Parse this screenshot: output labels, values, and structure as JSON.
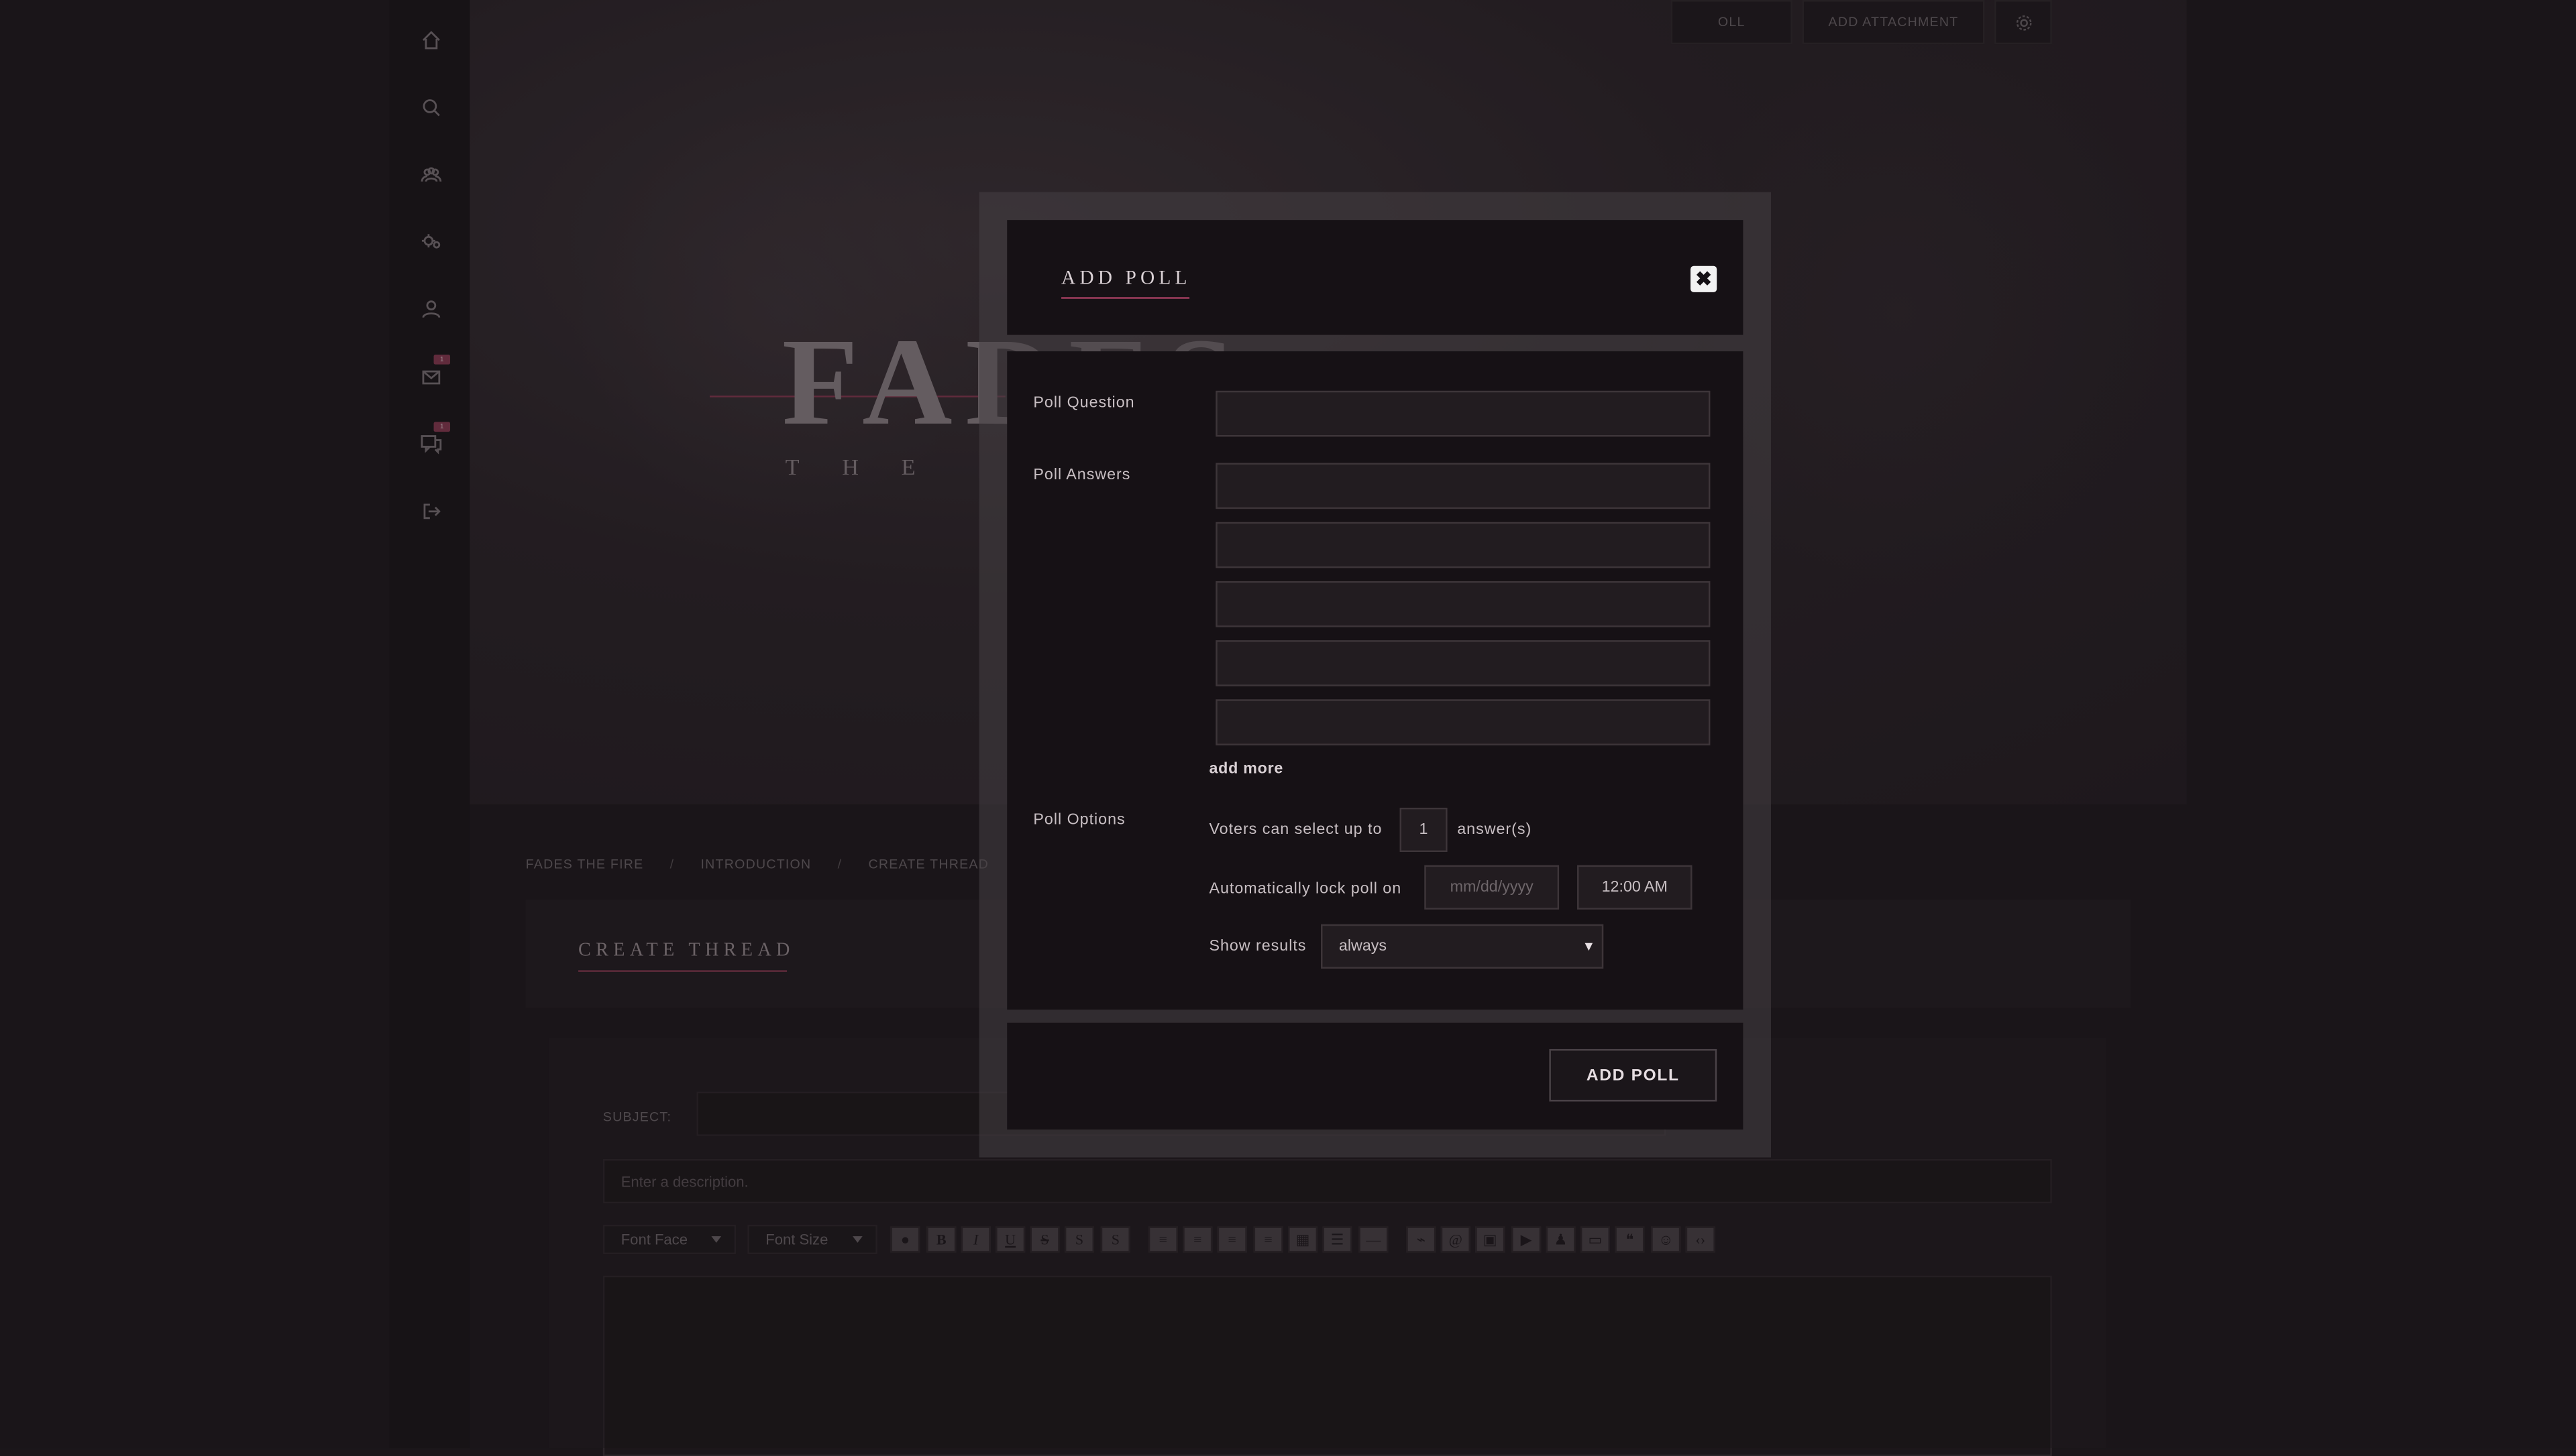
{
  "sidebar": {
    "items": [
      {
        "icon": "home-icon"
      },
      {
        "icon": "search-icon"
      },
      {
        "icon": "members-icon"
      },
      {
        "icon": "settings-icon"
      },
      {
        "icon": "user-icon"
      },
      {
        "icon": "mail-icon",
        "badge": "1"
      },
      {
        "icon": "chat-icon",
        "badge": "1"
      },
      {
        "icon": "logout-icon"
      }
    ]
  },
  "hero": {
    "title": "FADES",
    "subtitle": "THE"
  },
  "breadcrumb": {
    "items": [
      "FADES THE FIRE",
      "INTRODUCTION",
      "CREATE THREAD"
    ],
    "separator": "/"
  },
  "create_thread": {
    "title": "CREATE THREAD",
    "subject_label": "SUBJECT:",
    "poll_button_partial": "OLL",
    "add_attachment": "ADD ATTACHMENT",
    "description_placeholder": "Enter a description.",
    "font_face": "Font Face",
    "font_size": "Font Size"
  },
  "modal": {
    "title": "ADD POLL",
    "close_symbol": "✖",
    "question_label": "Poll Question",
    "answers_label": "Poll Answers",
    "add_more": "add more",
    "options_label": "Poll Options",
    "voters_prefix": "Voters can select up to",
    "voters_value": "1",
    "voters_suffix": "answer(s)",
    "lock_label": "Automatically lock poll on",
    "date_placeholder": "mm/dd/yyyy",
    "time_value": "12:00 AM",
    "show_results_label": "Show results",
    "show_results_value": "always",
    "submit": "ADD POLL"
  },
  "colors": {
    "accent": "#a23e5f",
    "background": "#1e181c",
    "modal_bg": "#161115"
  }
}
